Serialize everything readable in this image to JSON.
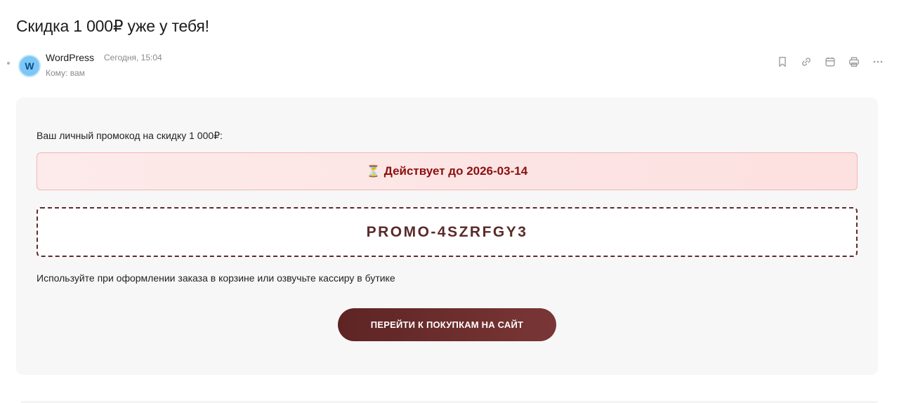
{
  "email": {
    "subject": "Скидка 1 000₽ уже у тебя!",
    "sender": {
      "name": "WordPress",
      "avatar_letter": "W",
      "date": "Сегодня, 15:04",
      "recipient": "Кому: вам"
    },
    "actions": [
      {
        "icon": "bookmark-icon"
      },
      {
        "icon": "link-icon"
      },
      {
        "icon": "calendar-icon"
      },
      {
        "icon": "print-icon"
      },
      {
        "icon": "more-icon"
      }
    ]
  },
  "body": {
    "intro": "Ваш личный промокод на скидку 1 000₽:",
    "validity_icon": "⏳",
    "validity": "Действует до 2026-03-14",
    "promo_code": "PROMO-4SZRFGY3",
    "usage": "Используйте при оформлении заказа в корзине или озвучьте кассиру в бутике",
    "cta_label": "ПЕРЕЙТИ К ПОКУПКАМ НА САЙТ"
  },
  "colors": {
    "accent": "#6a2c2c",
    "validity_bg": "#fde4e4",
    "validity_text": "#8b0f0f",
    "avatar": "#7cc7f5"
  }
}
